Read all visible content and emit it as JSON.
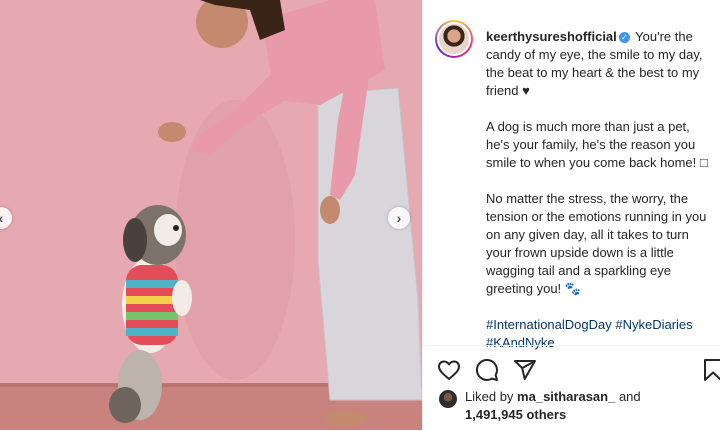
{
  "post": {
    "username": "keerthysureshofficial",
    "caption_p1": "You're the candy of my eye, the smile to my day, the beat to my heart & the best to my friend ♥",
    "caption_p2": "A dog is much more than just a pet, he's your family, he's the reason you smile to when you come back home! □",
    "caption_p3": "No matter the stress, the worry, the tension or the emotions running in you on any given day, all it takes to turn your frown upside down is a little wagging tail and a sparkling eye greeting you! 🐾",
    "hashtags_line1": "#InternationalDogDay #NykeDiaries",
    "hashtags_line2": "#KAndNyke"
  },
  "likes": {
    "prefix": "Liked by",
    "user": "ma_sitharasan_",
    "connector": "and",
    "count": "1,491,945 others"
  },
  "icons": {
    "like": "heart-icon",
    "comment": "comment-icon",
    "share": "share-icon",
    "save": "bookmark-icon",
    "verified": "verified-badge-icon",
    "prev": "chevron-left-icon",
    "next": "chevron-right-icon"
  },
  "colors": {
    "link": "#00376b",
    "verified": "#3897f0",
    "wall": "#e6a8b1"
  },
  "carousel": {
    "prev": "‹",
    "next": "›"
  },
  "verified_mark": "✓"
}
